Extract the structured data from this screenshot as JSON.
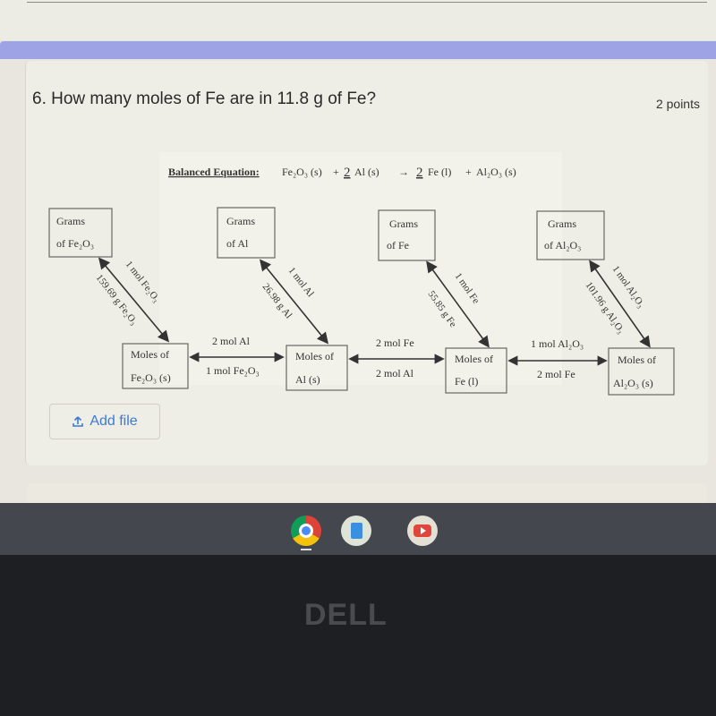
{
  "question": {
    "title": "6. How many moles of Fe are in 11.8 g of Fe?",
    "points": "2 points"
  },
  "diagram": {
    "equation_label": "Balanced Equation:",
    "equation": {
      "reactant1": "Fe₂O₃ (s)",
      "plus1": "+",
      "coef_al": "2",
      "reactant2": "Al (s)",
      "arrow": "→",
      "coef_fe": "2",
      "product1": "Fe (l)",
      "plus2": "+",
      "product2": "Al₂O₃ (s)"
    },
    "gram_boxes": [
      {
        "line1": "Grams",
        "line2": "of Fe₂O₃"
      },
      {
        "line1": "Grams",
        "line2": "of Al"
      },
      {
        "line1": "Grams",
        "line2": "of Fe"
      },
      {
        "line1": "Grams",
        "line2": "of Al₂O₃"
      }
    ],
    "mole_boxes": [
      {
        "line1": "Moles of",
        "line2": "Fe₂O₃ (s)"
      },
      {
        "line1": "Moles of",
        "line2": "Al (s)"
      },
      {
        "line1": "Moles of",
        "line2": "Fe (l)"
      },
      {
        "line1": "Moles of",
        "line2": "Al₂O₃ (s)"
      }
    ],
    "diagonal_labels": [
      {
        "top": "1 mol Fe₂O₃",
        "bottom": "159.69 g Fe₂O₃"
      },
      {
        "top": "1 mol Al",
        "bottom": "26.98 g Al"
      },
      {
        "top": "1 mol Fe",
        "bottom": "55.85 g Fe"
      },
      {
        "top": "1 mol Al₂O₃",
        "bottom": "101.96 g Al₂O₃"
      }
    ],
    "horizontal_labels": [
      {
        "top": "2 mol Al",
        "bottom": "1 mol Fe₂O₃"
      },
      {
        "top": "2 mol Fe",
        "bottom": "2 mol Al"
      },
      {
        "top": "1 mol Al₂O₃",
        "bottom": "2 mol Fe"
      }
    ]
  },
  "add_file": {
    "label": "Add file",
    "icon": "upload-icon"
  },
  "shelf": {
    "apps": [
      {
        "name": "chrome-icon",
        "color": "#4c8bf5"
      },
      {
        "name": "docs-icon",
        "color": "#3a8fe0"
      },
      {
        "name": "youtube-icon",
        "color": "#e0463a"
      }
    ]
  },
  "bezel": {
    "brand": "DELL"
  }
}
